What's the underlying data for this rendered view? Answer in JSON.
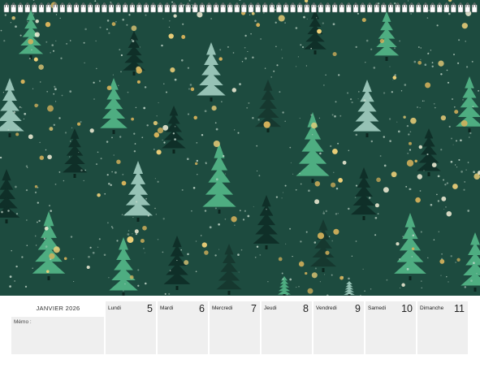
{
  "calendar": {
    "month_title": "JANVIER 2026",
    "memo_label": "Mémo :",
    "days": [
      {
        "name": "Lundi",
        "num": "5"
      },
      {
        "name": "Mardi",
        "num": "6"
      },
      {
        "name": "Mercredi",
        "num": "7"
      },
      {
        "name": "Jeudi",
        "num": "8"
      },
      {
        "name": "Vendredi",
        "num": "9"
      },
      {
        "name": "Samedi",
        "num": "10"
      },
      {
        "name": "Dimanche",
        "num": "11"
      }
    ]
  },
  "artwork": {
    "background_color": "#1d4b3f",
    "tree_colors": [
      "#54b889",
      "#7fcba6",
      "#a4cfc2",
      "#0f2e27",
      "#16382f"
    ],
    "snow_colors": [
      "#f1d27a",
      "#c9dccf",
      "#d6b25b"
    ]
  },
  "icons": [
    "spiral-binding-icon"
  ]
}
